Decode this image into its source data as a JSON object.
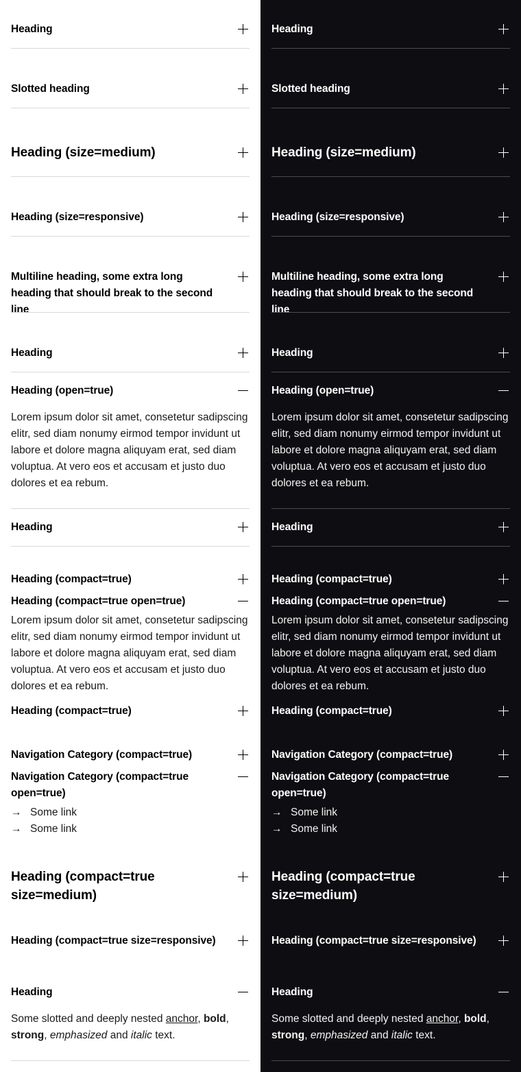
{
  "accordions": {
    "heading": "Heading",
    "slotted_heading": "Slotted heading",
    "heading_medium": "Heading (size=medium)",
    "heading_responsive": "Heading (size=responsive)",
    "multiline_heading": "Multiline heading, some extra long heading that should break to the second line",
    "heading_open": "Heading (open=true)",
    "lorem": "Lorem ipsum dolor sit amet, consetetur sadipscing elitr, sed diam nonumy eirmod tempor invidunt ut labore et dolore magna aliquyam erat, sed diam voluptua. At vero eos et accusam et justo duo dolores et ea rebum.",
    "heading_compact": "Heading (compact=true)",
    "heading_compact_open": "Heading (compact=true open=true)",
    "nav_compact": "Navigation Category (compact=true)",
    "nav_compact_open": "Navigation Category (compact=true open=true)",
    "some_link": "Some link",
    "heading_compact_medium": "Heading (compact=true size=medium)",
    "heading_compact_responsive": "Heading (compact=true size=responsive)",
    "slotted_text": {
      "before": "Some slotted and deeply nested ",
      "anchor": "anchor",
      "comma1": ", ",
      "bold": "bold",
      "comma2": ", ",
      "strong": "strong",
      "comma3": ", ",
      "emphasized": "emphasized",
      "and": " and ",
      "italic": "italic",
      "after": " text."
    }
  },
  "icons": {
    "expand": "plus-icon",
    "collapse": "minus-icon",
    "link": "arrow-right-icon"
  }
}
